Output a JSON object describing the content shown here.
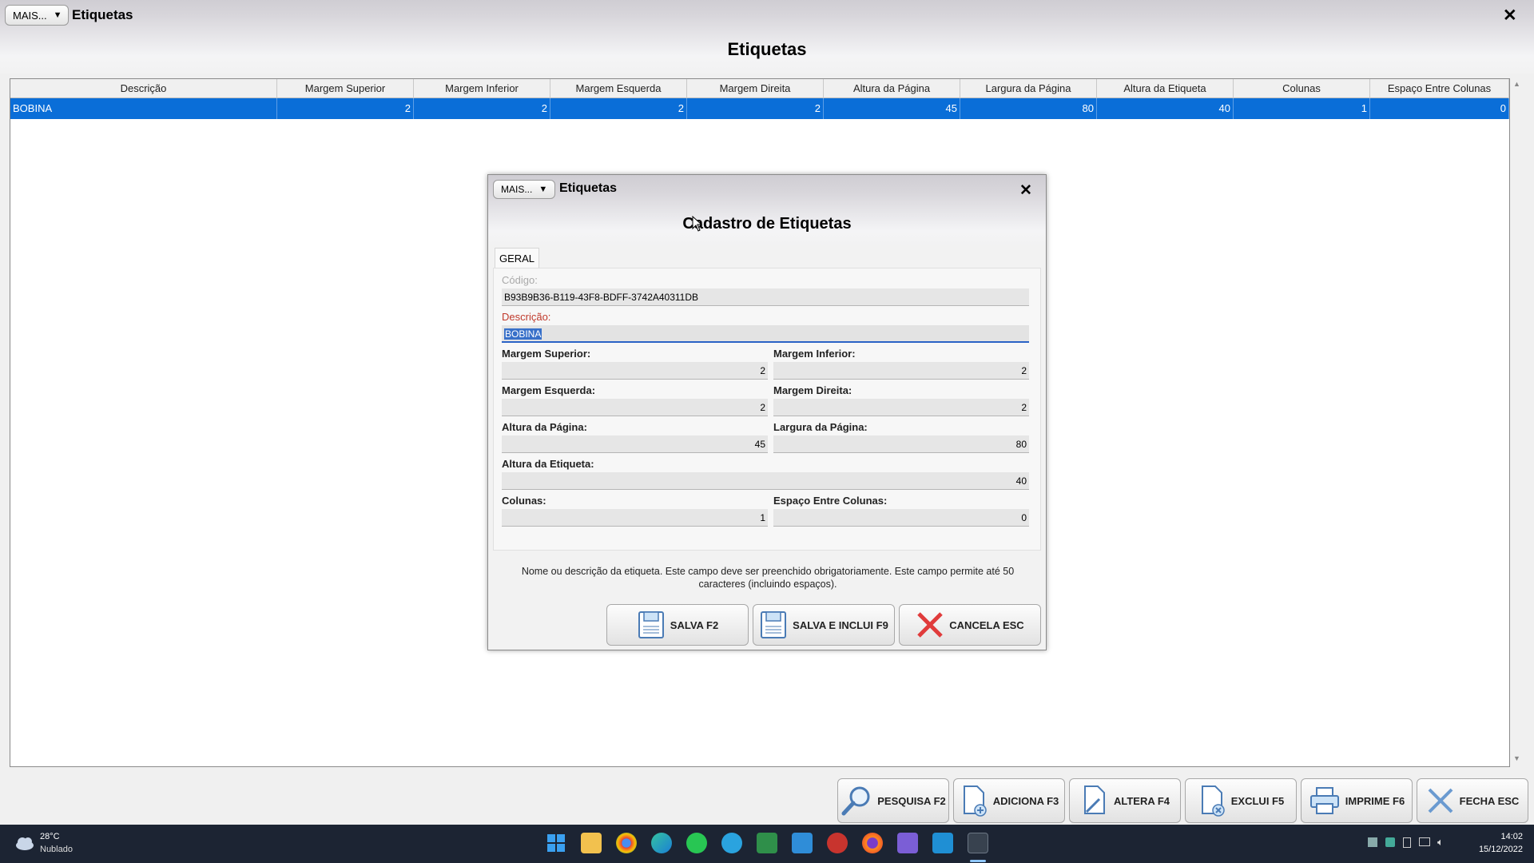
{
  "window": {
    "mais_label": "MAIS...",
    "title": "Etiquetas",
    "close_glyph": "✕",
    "page_title": "Etiquetas"
  },
  "grid": {
    "columns": [
      "Descrição",
      "Margem Superior",
      "Margem Inferior",
      "Margem Esquerda",
      "Margem Direita",
      "Altura da Página",
      "Largura da Página",
      "Altura da Etiqueta",
      "Colunas",
      "Espaço Entre Colunas"
    ],
    "rows": [
      [
        "BOBINA",
        "2",
        "2",
        "2",
        "2",
        "45",
        "80",
        "40",
        "1",
        "0"
      ]
    ],
    "selected_row_color": "#0a6ed8"
  },
  "toolbar": {
    "pesquisa": "PESQUISA F2",
    "adiciona": "ADICIONA F3",
    "altera": "ALTERA F4",
    "exclui": "EXCLUI F5",
    "imprime": "IMPRIME F6",
    "fecha": "FECHA ESC"
  },
  "dialog": {
    "mais_label": "MAIS...",
    "title": "Etiquetas",
    "close_glyph": "✕",
    "form_title": "Cadastro de Etiquetas",
    "tab": "GERAL",
    "fields": {
      "codigo_label": "Código:",
      "codigo_value": "B93B9B36-B119-43F8-BDFF-3742A40311DB",
      "descricao_label": "Descrição:",
      "descricao_value": "BOBINA",
      "margem_superior_label": "Margem Superior:",
      "margem_superior_value": "2",
      "margem_inferior_label": "Margem Inferior:",
      "margem_inferior_value": "2",
      "margem_esquerda_label": "Margem Esquerda:",
      "margem_esquerda_value": "2",
      "margem_direita_label": "Margem Direita:",
      "margem_direita_value": "2",
      "altura_pagina_label": "Altura da Página:",
      "altura_pagina_value": "45",
      "largura_pagina_label": "Largura da Página:",
      "largura_pagina_value": "80",
      "altura_etiqueta_label": "Altura da Etiqueta:",
      "altura_etiqueta_value": "40",
      "colunas_label": "Colunas:",
      "colunas_value": "1",
      "espaco_colunas_label": "Espaço Entre Colunas:",
      "espaco_colunas_value": "0"
    },
    "hint": "Nome ou descrição da etiqueta. Este campo deve ser preenchido obrigatoriamente. Este campo permite até 50 caracteres (incluindo espaços).",
    "buttons": {
      "salva": "SALVA F2",
      "salva_inclui": "SALVA E INCLUI F9",
      "cancela": "CANCELA ESC"
    }
  },
  "taskbar": {
    "weather_temp": "28°C",
    "weather_desc": "Nublado",
    "time": "14:02",
    "date": "15/12/2022",
    "pinned_apps": [
      "start-icon",
      "file-explorer-icon",
      "chrome-icon",
      "edge-icon",
      "whatsapp-icon",
      "telegram-icon",
      "spreadsheet-icon",
      "messaging-icon",
      "app-icon",
      "firefox-icon",
      "media-icon",
      "mail-icon",
      "erp-app-icon"
    ]
  }
}
